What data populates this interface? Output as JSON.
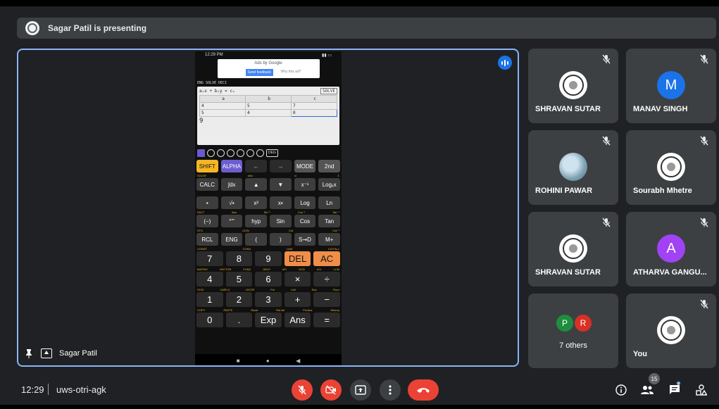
{
  "presenting_banner": {
    "text": "Sagar Patil is presenting"
  },
  "stage": {
    "presenter_name": "Sagar Patil",
    "phone": {
      "status_time": "12:29 PM",
      "ad": {
        "title": "Ads by Google",
        "feedback_button": "Send feedback",
        "why_link": "Why this ad?"
      },
      "mode_line": "ENG SOLVE DECI",
      "equation": "aₙx + bₙy = cₙ",
      "solve_label": "SOLVE",
      "table": {
        "headers": [
          "a",
          "b",
          "c"
        ],
        "rows": [
          [
            "4",
            "5",
            "7"
          ],
          [
            "5",
            "4",
            "0"
          ]
        ]
      },
      "input_value": "9",
      "deg_label": "DEG",
      "keys": {
        "row1": [
          "SHIFT",
          "ALPHA",
          "←",
          "→",
          "MODE",
          "2nd"
        ],
        "row2": [
          "CALC",
          "∫dx",
          "▲",
          "▼",
          "x⁻¹",
          "Logₓx"
        ],
        "row3": [
          "▪",
          "√▪",
          "x²",
          "x▪",
          "Log",
          "Ln"
        ],
        "row4": [
          "(−)",
          "°'\"",
          "hyp",
          "Sin",
          "Cos",
          "Tan"
        ],
        "row5": [
          "RCL",
          "ENG",
          "(",
          ")",
          "S⇝D",
          "M+"
        ],
        "row6": [
          "7",
          "8",
          "9",
          "DEL",
          "AC"
        ],
        "row7": [
          "4",
          "5",
          "6",
          "×",
          "÷"
        ],
        "row8": [
          "1",
          "2",
          "3",
          "+",
          "−"
        ],
        "row9": [
          "0",
          ".",
          "Exp",
          "Ans",
          "="
        ]
      },
      "sublabels": {
        "r1": [
          "SOLVE",
          "d/dx",
          "x!",
          "Σ"
        ],
        "r4": [
          "FACT",
          "Abs",
          "Sin⁻¹",
          "Cos⁻¹",
          "Tan⁻¹"
        ],
        "r5": [
          "STO",
          "CLRv",
          "Cot",
          "Cot⁻¹"
        ],
        "r6": [
          "CONST",
          "CONV",
          "Limit",
          "CLR ALL"
        ],
        "r7": [
          "MATRIX",
          "VECTOR",
          "FUNC",
          "HELP",
          "nPr",
          "GCD",
          "nCr",
          "LCM"
        ],
        "r8": [
          "STAT",
          "CMPLX",
          "DISTR",
          "Pol",
          "Ceil",
          "Rec",
          "Floor"
        ],
        "r9": [
          "COPY",
          "PASTE",
          "Ran#",
          "RanInt",
          "PreAns",
          "History"
        ]
      }
    }
  },
  "participants": [
    {
      "name": "SHRAVAN SUTAR",
      "avatar": "logo"
    },
    {
      "name": "MANAV SINGH",
      "avatar": "letter",
      "letter": "M",
      "color": "#1a73e8"
    },
    {
      "name": "ROHINI PAWAR",
      "avatar": "photo"
    },
    {
      "name": "Sourabh Mhetre",
      "avatar": "logo"
    },
    {
      "name": "SHRAVAN SUTAR",
      "avatar": "logo"
    },
    {
      "name": "ATHARVA GANGU...",
      "avatar": "letter",
      "letter": "A",
      "color": "#a142f4"
    },
    {
      "name": "7 others",
      "avatar": "group",
      "letters": [
        "P",
        "R"
      ],
      "colors": [
        "#1e8e3e",
        "#d93025"
      ]
    },
    {
      "name": "You",
      "avatar": "logo"
    }
  ],
  "bottom_bar": {
    "time": "12:29",
    "meeting_code": "uws-otri-agk",
    "people_count": "15",
    "icons": [
      "mic-off-icon",
      "camera-off-icon",
      "present-icon",
      "more-icon",
      "end-call-icon",
      "info-icon",
      "people-icon",
      "chat-icon",
      "activities-icon"
    ]
  }
}
